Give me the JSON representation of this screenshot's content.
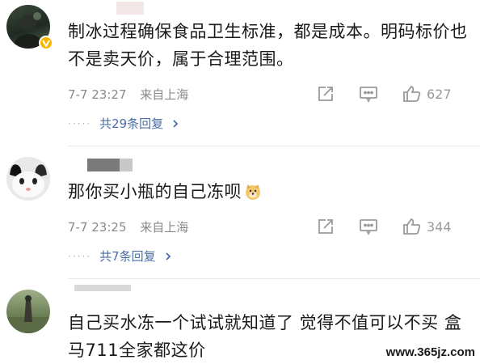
{
  "comments": [
    {
      "text": "制冰过程确保食品卫生标准，都是成本。明码标价也不是卖天价，属于合理范围。",
      "date": "7-7 23:27",
      "location": "来自上海",
      "likes": "627",
      "replies": "共29条回复",
      "avatar_icon": "user-avatar-dark-icon",
      "badge_icon": "verified-badge-icon"
    },
    {
      "text": "那你买小瓶的自己冻呗",
      "emoji_icon": "doge-emoji-icon",
      "date": "7-7 23:25",
      "location": "来自上海",
      "likes": "344",
      "replies": "共7条回复",
      "avatar_icon": "cat-avatar-icon"
    },
    {
      "text": "自己买水冻一个试试就知道了 觉得不值可以不买 盒马711全家都这价",
      "avatar_icon": "outdoor-avatar-icon"
    }
  ],
  "actions": {
    "share_icon": "share-icon",
    "comment_icon": "comment-icon",
    "like_icon": "thumbs-up-icon",
    "reply_chevron_icon": "chevron-right-icon"
  },
  "watermark": "www.365jz.com",
  "colors": {
    "text": "#1a1a1a",
    "meta": "#8a8a8a",
    "link": "#4a6ea8",
    "badge": "#f7b500"
  }
}
